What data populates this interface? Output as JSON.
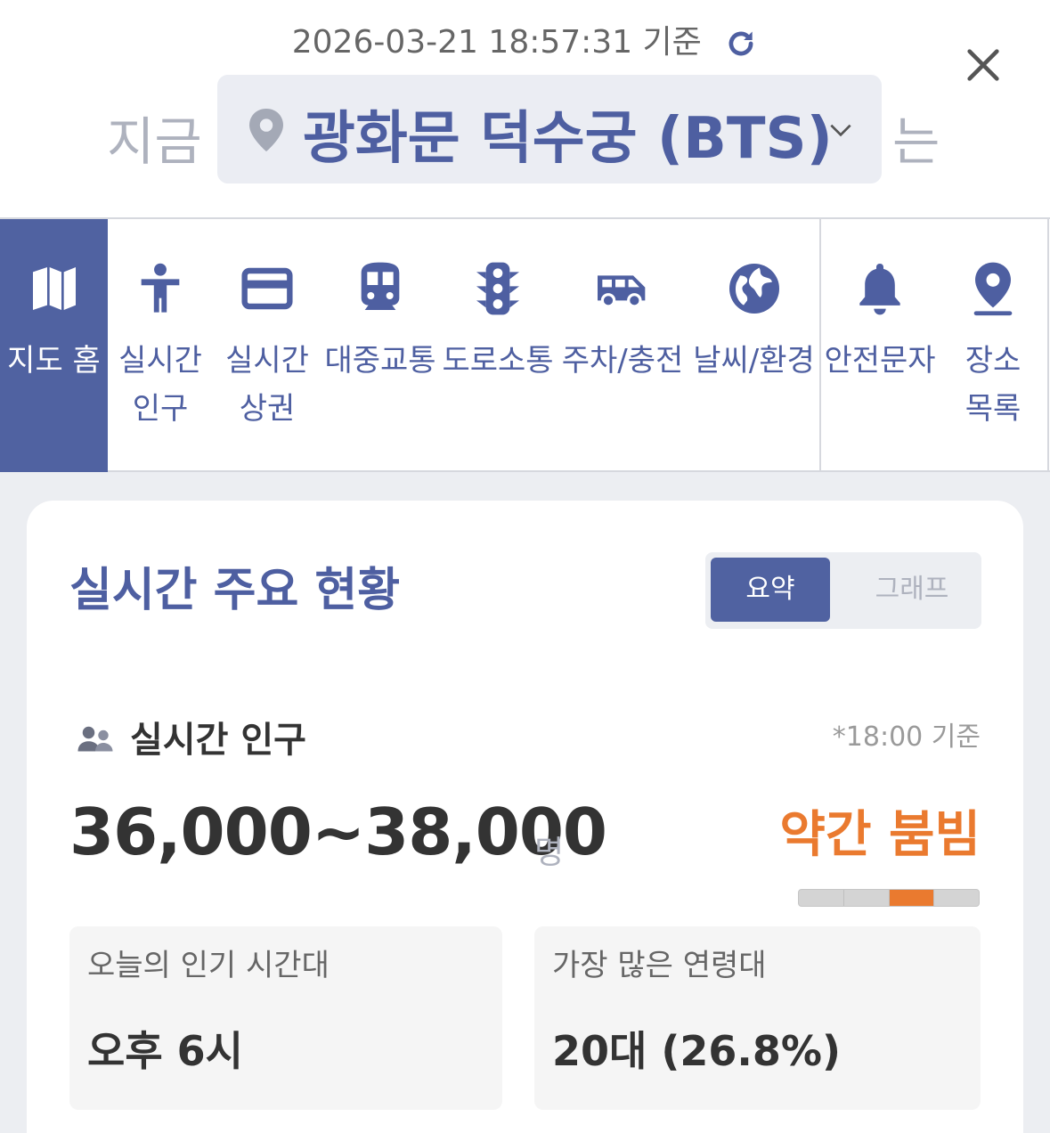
{
  "header": {
    "timestamp": "2026-03-21 18:57:31 기준",
    "prefix": "지금",
    "location": "광화문 덕수궁 (BTS)",
    "suffix": "는"
  },
  "nav": {
    "items": [
      {
        "label": "지도 홈",
        "icon": "map-icon",
        "active": true
      },
      {
        "label": "실시간\n인구",
        "icon": "person-icon"
      },
      {
        "label": "실시간\n상권",
        "icon": "card-icon"
      },
      {
        "label": "대중교통",
        "icon": "train-icon"
      },
      {
        "label": "도로소통",
        "icon": "traffic-light-icon"
      },
      {
        "label": "주차/충전",
        "icon": "van-icon"
      },
      {
        "label": "날씨/환경",
        "icon": "globe-icon"
      },
      {
        "label": "안전문자",
        "icon": "bell-icon"
      },
      {
        "label": "장소\n목록",
        "icon": "pin-icon"
      }
    ]
  },
  "card": {
    "title": "실시간 주요 현황",
    "toggle": {
      "summary": "요약",
      "graph": "그래프",
      "selected": "요약"
    },
    "population": {
      "title": "실시간 인구",
      "note": "*18:00 기준",
      "range": "36,000~38,000",
      "unit": "명",
      "congestion": "약간 붐빔",
      "congestion_level": 3,
      "congestion_levels": 4
    },
    "stats": [
      {
        "label": "오늘의 인기 시간대",
        "value": "오후 6시"
      },
      {
        "label": "가장 많은 연령대",
        "value": "20대 (26.8%)"
      }
    ]
  },
  "colors": {
    "primary": "#5062a1",
    "accent": "#ea7a2f",
    "muted": "#aeb2be"
  }
}
